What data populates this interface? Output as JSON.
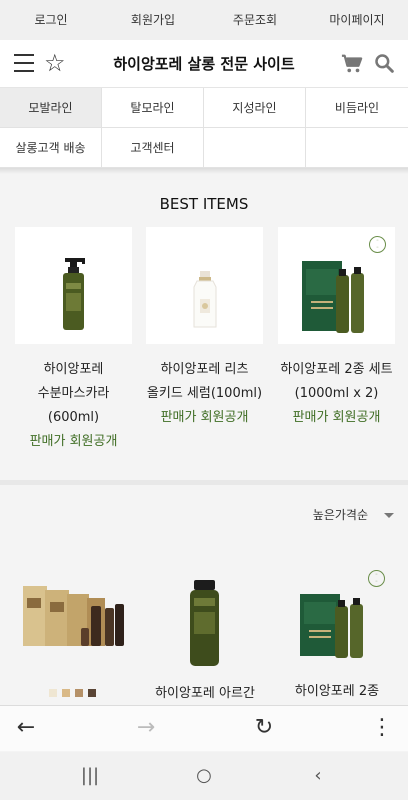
{
  "topnav": [
    {
      "label": "로그인"
    },
    {
      "label": "회원가입"
    },
    {
      "label": "주문조회"
    },
    {
      "label": "마이페이지"
    }
  ],
  "header": {
    "title": "하이앙포레 살롱 전문 사이트",
    "icons": [
      "menu-icon",
      "star-icon",
      "cart-icon",
      "search-icon"
    ]
  },
  "categories": [
    {
      "label": "모발라인",
      "active": true
    },
    {
      "label": "탈모라인"
    },
    {
      "label": "지성라인"
    },
    {
      "label": "비듬라인"
    },
    {
      "label": "살롱고객 배송"
    },
    {
      "label": "고객센터"
    }
  ],
  "best": {
    "title": "BEST ITEMS",
    "items": [
      {
        "name_line1": "하이앙포레",
        "name_line2": "수분마스카라",
        "name_line3": "(600ml)",
        "price": "판매가 회원공개"
      },
      {
        "name_line1": "하이앙포레 리츠",
        "name_line2": "올키드 세럼(100ml)",
        "price": "판매가 회원공개"
      },
      {
        "name_line1": "하이앙포레 2종 세트",
        "name_line2": "(1000ml x 2)",
        "price": "판매가 회원공개"
      }
    ]
  },
  "list": {
    "sort_label": "높은가격순",
    "items": [
      {
        "name": ""
      },
      {
        "name": "하이앙포레 아르간"
      },
      {
        "name": "하이앙포레 2종"
      }
    ]
  },
  "colors": {
    "accent_green": "#3f6d24",
    "bottle_green": "#4b5b21",
    "box_green": "#1f5a38"
  }
}
